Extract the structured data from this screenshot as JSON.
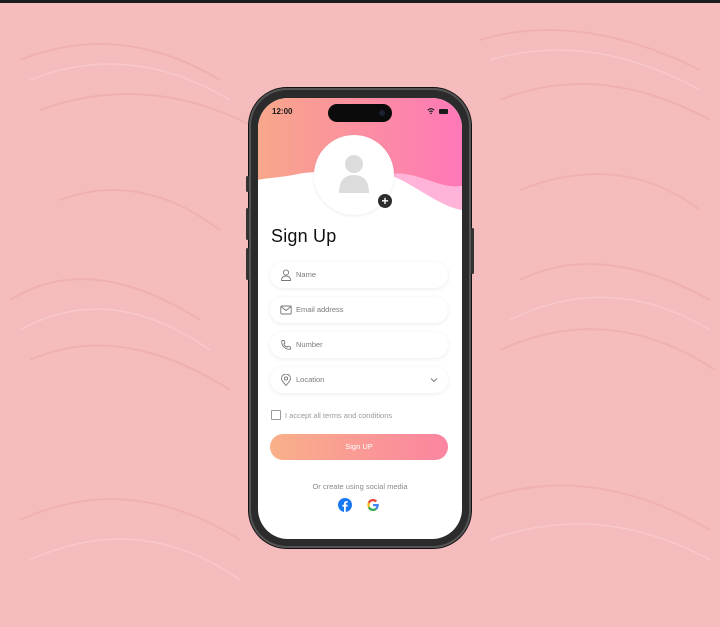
{
  "status_bar": {
    "time": "12:00"
  },
  "form": {
    "title": "Sign Up",
    "name_placeholder": "Name",
    "email_placeholder": "Email address",
    "number_placeholder": "Number",
    "location_placeholder": "Location",
    "terms_label": "I accept all terms and conditions",
    "submit_label": "Sign UP",
    "social_label": "Or create using social media"
  },
  "icons": {
    "avatar": "user-avatar-icon",
    "add": "plus-icon",
    "name": "user-icon",
    "email": "mail-icon",
    "number": "phone-icon",
    "location": "location-pin-icon",
    "dropdown": "chevron-down-icon",
    "facebook": "facebook-icon",
    "google": "google-icon"
  },
  "colors": {
    "background": "#f5bcbd",
    "gradient_start": "#f9b089",
    "gradient_end": "#fb84a0",
    "wave_pink": "#ff7ab6",
    "facebook": "#1877f2"
  }
}
